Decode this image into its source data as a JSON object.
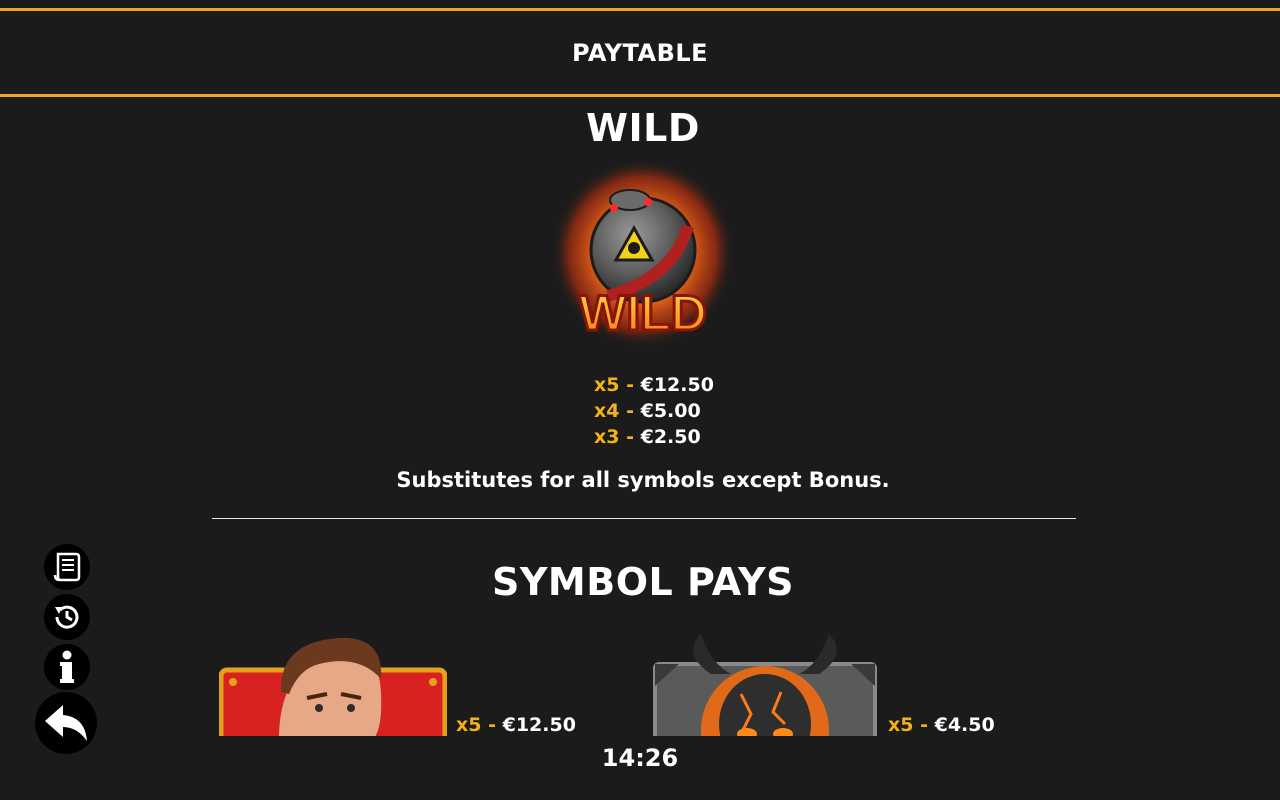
{
  "header": {
    "title": "PAYTABLE"
  },
  "wild": {
    "title": "WILD",
    "icon_label": "WILD",
    "pays": [
      {
        "mult": "x5 -",
        "value": "€12.50"
      },
      {
        "mult": "x4 -",
        "value": "€5.00"
      },
      {
        "mult": "x3 -",
        "value": "€2.50"
      }
    ],
    "description": "Substitutes for all symbols except Bonus."
  },
  "symbol_pays": {
    "title": "SYMBOL PAYS",
    "items": [
      {
        "icon": "hero-portrait",
        "mult": "x5 -",
        "value": "€12.50"
      },
      {
        "icon": "demon-skull",
        "mult": "x5 -",
        "value": "€4.50"
      }
    ]
  },
  "status": {
    "clock": "14:26"
  },
  "side_buttons": {
    "rules_icon": "scroll-icon",
    "history_icon": "history-icon",
    "info_icon": "info-icon",
    "back_icon": "back-arrow-icon"
  },
  "colors": {
    "accent": "#f2a227",
    "multiplier": "#f2b21b",
    "background": "#1b1b1b"
  }
}
